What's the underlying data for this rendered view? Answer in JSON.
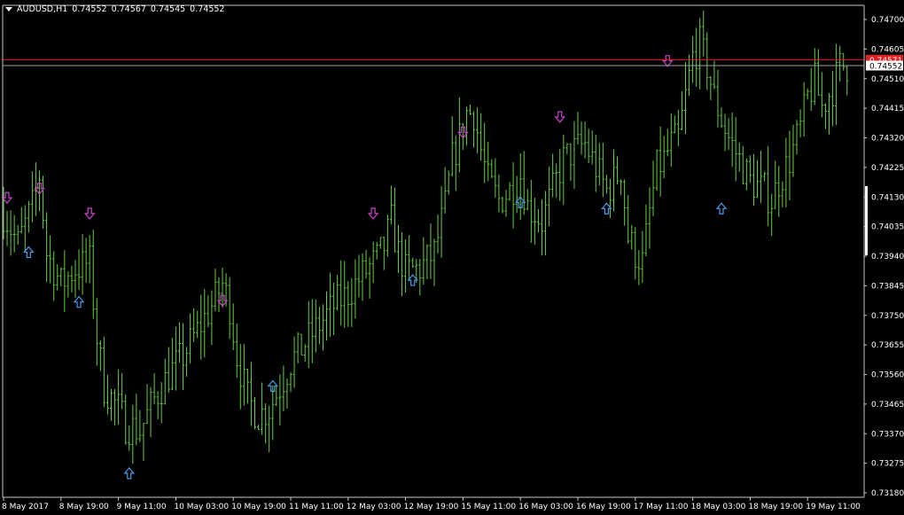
{
  "header": {
    "symbol_label": "AUDUSD,H1",
    "open": "0.74552",
    "high": "0.74567",
    "low": "0.74545",
    "close": "0.74552"
  },
  "colors": {
    "background": "#000000",
    "bar_up": "#66cc44",
    "bar_down": "#66cc44",
    "axis": "#c8c8c8",
    "arrow_up": "#4a9be8",
    "arrow_down": "#cc44cc",
    "ask_line": "#e02020",
    "bid_line": "#a0a0a0"
  },
  "chart_data": {
    "type": "ohlc",
    "symbol": "AUDUSD",
    "timeframe": "H1",
    "ylim": [
      0.7318,
      0.747
    ],
    "y_ticks": [
      "0.74700",
      "0.74605",
      "0.74510",
      "0.74415",
      "0.74320",
      "0.74225",
      "0.74130",
      "0.74035",
      "0.73940",
      "0.73845",
      "0.73750",
      "0.73655",
      "0.73560",
      "0.73465",
      "0.73370",
      "0.73275",
      "0.73180"
    ],
    "x_ticks": [
      "8 May 2017",
      "8 May 19:00",
      "9 May 11:00",
      "10 May 03:00",
      "10 May 19:00",
      "11 May 11:00",
      "12 May 03:00",
      "12 May 19:00",
      "15 May 11:00",
      "16 May 03:00",
      "16 May 19:00",
      "17 May 11:00",
      "18 May 03:00",
      "18 May 19:00",
      "19 May 11:00"
    ],
    "x_tick_bar_index": [
      0,
      16,
      32,
      48,
      64,
      80,
      96,
      112,
      128,
      144,
      160,
      176,
      192,
      208,
      224
    ],
    "ask_price": 0.74571,
    "ask_label": "0.74571",
    "bid_price": 0.74552,
    "bid_label": "0.74552",
    "close_path": [
      [
        0,
        0.7408
      ],
      [
        4,
        0.7398
      ],
      [
        8,
        0.741
      ],
      [
        10,
        0.742
      ],
      [
        12,
        0.7395
      ],
      [
        16,
        0.7385
      ],
      [
        20,
        0.739
      ],
      [
        24,
        0.7392
      ],
      [
        26,
        0.7368
      ],
      [
        28,
        0.7352
      ],
      [
        32,
        0.7345
      ],
      [
        34,
        0.734
      ],
      [
        38,
        0.7338
      ],
      [
        42,
        0.7348
      ],
      [
        46,
        0.7356
      ],
      [
        50,
        0.7362
      ],
      [
        54,
        0.737
      ],
      [
        58,
        0.7378
      ],
      [
        61,
        0.7385
      ],
      [
        63,
        0.7378
      ],
      [
        65,
        0.7362
      ],
      [
        68,
        0.7348
      ],
      [
        71,
        0.7343
      ],
      [
        74,
        0.7345
      ],
      [
        77,
        0.7352
      ],
      [
        80,
        0.736
      ],
      [
        84,
        0.7366
      ],
      [
        88,
        0.7372
      ],
      [
        92,
        0.7378
      ],
      [
        96,
        0.7382
      ],
      [
        100,
        0.7388
      ],
      [
        104,
        0.7393
      ],
      [
        106,
        0.7397
      ],
      [
        108,
        0.7405
      ],
      [
        110,
        0.7395
      ],
      [
        112,
        0.7389
      ],
      [
        116,
        0.739
      ],
      [
        120,
        0.7395
      ],
      [
        123,
        0.741
      ],
      [
        125,
        0.7425
      ],
      [
        127,
        0.7432
      ],
      [
        129,
        0.744
      ],
      [
        131,
        0.744
      ],
      [
        133,
        0.7428
      ],
      [
        135,
        0.7418
      ],
      [
        138,
        0.7412
      ],
      [
        141,
        0.7415
      ],
      [
        144,
        0.742
      ],
      [
        146,
        0.741
      ],
      [
        148,
        0.7408
      ],
      [
        150,
        0.7405
      ],
      [
        153,
        0.7415
      ],
      [
        156,
        0.7425
      ],
      [
        159,
        0.7428
      ],
      [
        162,
        0.743
      ],
      [
        164,
        0.7425
      ],
      [
        166,
        0.742
      ],
      [
        168,
        0.7415
      ],
      [
        170,
        0.7418
      ],
      [
        172,
        0.7422
      ],
      [
        174,
        0.74
      ],
      [
        176,
        0.7395
      ],
      [
        178,
        0.7392
      ],
      [
        180,
        0.7408
      ],
      [
        182,
        0.7422
      ],
      [
        184,
        0.7425
      ],
      [
        186,
        0.743
      ],
      [
        188,
        0.7432
      ],
      [
        190,
        0.7445
      ],
      [
        192,
        0.7458
      ],
      [
        194,
        0.7462
      ],
      [
        196,
        0.7455
      ],
      [
        198,
        0.7445
      ],
      [
        200,
        0.7438
      ],
      [
        202,
        0.7432
      ],
      [
        205,
        0.7425
      ],
      [
        208,
        0.7418
      ],
      [
        212,
        0.7415
      ],
      [
        214,
        0.7412
      ],
      [
        216,
        0.7418
      ],
      [
        219,
        0.7425
      ],
      [
        222,
        0.7435
      ],
      [
        224,
        0.7445
      ],
      [
        226,
        0.745
      ],
      [
        228,
        0.7442
      ],
      [
        231,
        0.7448
      ],
      [
        233,
        0.7455
      ],
      [
        235,
        0.74552
      ]
    ],
    "arrows_up": [
      [
        7,
        0.7397
      ],
      [
        21,
        0.7381
      ],
      [
        35,
        0.7326
      ],
      [
        75,
        0.7354
      ],
      [
        114,
        0.7388
      ],
      [
        144,
        0.7413
      ],
      [
        168,
        0.7411
      ],
      [
        200,
        0.7411
      ]
    ],
    "arrows_down": [
      [
        1,
        0.7411
      ],
      [
        10,
        0.7414
      ],
      [
        24,
        0.7406
      ],
      [
        61,
        0.7378
      ],
      [
        103,
        0.7406
      ],
      [
        128,
        0.7432
      ],
      [
        155,
        0.7437
      ],
      [
        185,
        0.7455
      ]
    ]
  }
}
